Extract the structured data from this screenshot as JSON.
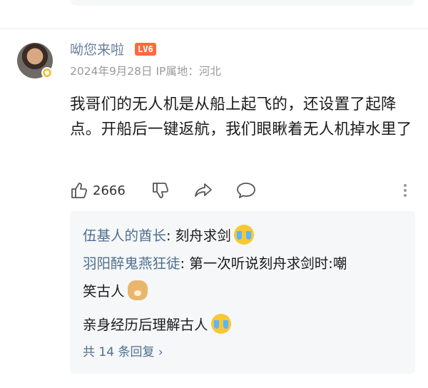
{
  "comment": {
    "username": "呦您来啦",
    "level_badge": "LV6",
    "meta": "2024年9月28日 IP属地：河北",
    "text": "我哥们的无人机是从船上起飞的，还设置了起降点。开船后一键返航，我们眼瞅着无人机掉水里了",
    "like_count": "2666"
  },
  "icons": [
    "thumbs-up-icon",
    "thumbs-down-icon",
    "share-icon",
    "comment-icon",
    "more-icon"
  ],
  "replies": {
    "items": [
      {
        "name": "伍基人的酋长",
        "separator": ": ",
        "text": "刻舟求剑"
      },
      {
        "name": "羽阳醉鬼燕狂徒",
        "separator": ": ",
        "text_line1": "第一次听说刻舟求剑时:嘲",
        "text_line2": "笑古人"
      },
      {
        "text": "亲身经历后理解古人"
      }
    ],
    "total_label": "共 14 条回复 ›"
  },
  "colors": {
    "username": "#6a7e9c",
    "level_badge_bg": "#ff6a3a",
    "reply_name": "#4f6f8f",
    "reply_bg": "#f6f7f9"
  }
}
